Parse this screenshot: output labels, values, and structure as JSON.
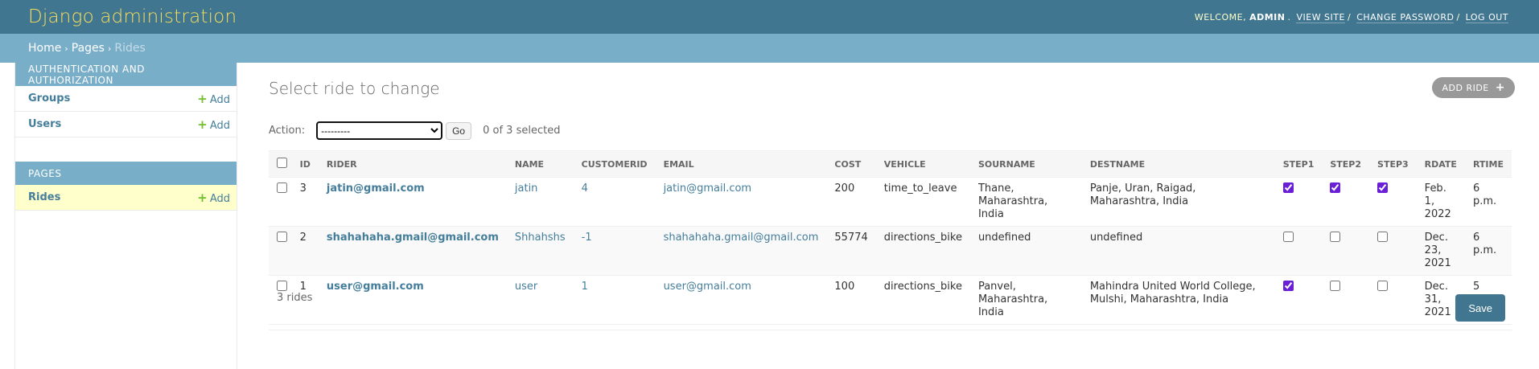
{
  "header": {
    "branding": "Django administration",
    "welcome": "WELCOME,",
    "user": "ADMIN",
    "view_site": "VIEW SITE",
    "change_password": "CHANGE PASSWORD",
    "log_out": "LOG OUT"
  },
  "breadcrumbs": {
    "home": "Home",
    "pages": "Pages",
    "current": "Rides"
  },
  "sidebar": {
    "auth_caption": "AUTHENTICATION AND AUTHORIZATION",
    "groups": "Groups",
    "users": "Users",
    "pages_caption": "PAGES",
    "rides": "Rides",
    "add_label": "Add"
  },
  "content": {
    "title": "Select ride to change",
    "add_button": "ADD RIDE",
    "action_label": "Action:",
    "action_selected": "---------",
    "go_label": "Go",
    "counter": "0 of 3 selected",
    "paginator": "3 rides",
    "save_label": "Save"
  },
  "table": {
    "columns": [
      "ID",
      "RIDER",
      "NAME",
      "CUSTOMERID",
      "EMAIL",
      "COST",
      "VEHICLE",
      "SOURNAME",
      "DESTNAME",
      "STEP1",
      "STEP2",
      "STEP3",
      "RDATE",
      "RTIME"
    ],
    "rows": [
      {
        "id": "3",
        "rider": "jatin@gmail.com",
        "name": "jatin",
        "customerid": "4",
        "email": "jatin@gmail.com",
        "cost": "200",
        "vehicle": "time_to_leave",
        "sourname": "Thane, Maharashtra, India",
        "destname": "Panje, Uran, Raigad, Maharashtra, India",
        "step1": true,
        "step2": true,
        "step3": true,
        "rdate": "Feb. 1, 2022",
        "rtime": "6 p.m."
      },
      {
        "id": "2",
        "rider": "shahahaha.gmail@gmail.com",
        "name": "Shhahshs",
        "customerid": "-1",
        "email": "shahahaha.gmail@gmail.com",
        "cost": "55774",
        "vehicle": "directions_bike",
        "sourname": "undefined",
        "destname": "undefined",
        "step1": false,
        "step2": false,
        "step3": false,
        "rdate": "Dec. 23, 2021",
        "rtime": "6 p.m."
      },
      {
        "id": "1",
        "rider": "user@gmail.com",
        "name": "user",
        "customerid": "1",
        "email": "user@gmail.com",
        "cost": "100",
        "vehicle": "directions_bike",
        "sourname": "Panvel, Maharashtra, India",
        "destname": "Mahindra United World College, Mulshi, Maharashtra, India",
        "step1": true,
        "step2": false,
        "step3": false,
        "rdate": "Dec. 31, 2021",
        "rtime": "5 p.m."
      }
    ]
  },
  "colors": {
    "header_bg": "#417690",
    "breadcrumb_bg": "#79aec8",
    "branding": "#f5dd5d",
    "link": "#447e9b",
    "add_plus": "#70bf2b",
    "current_row": "#ffffcc"
  },
  "icons": {
    "add": "plus-icon",
    "dropdown": "chevron-down-icon"
  }
}
